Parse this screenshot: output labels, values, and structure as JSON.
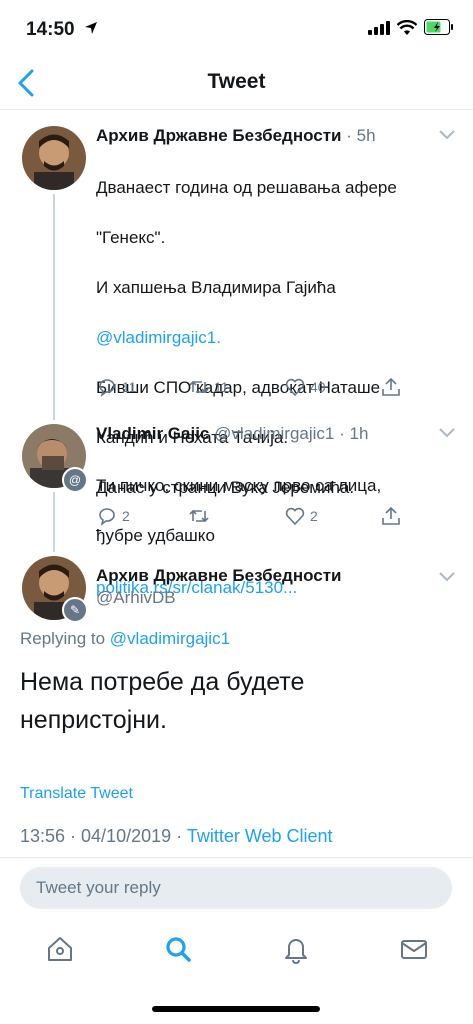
{
  "status": {
    "time": "14:50"
  },
  "nav": {
    "title": "Tweet"
  },
  "tweet1": {
    "name": "Архив Државне Безбедности",
    "meta": "· 5h",
    "text_lines": [
      "Дванаест година од решавања афере",
      "\"Генекс\".",
      "И хапшења Владимира Гајића",
      "Бивши СПО кадар, адвокат Наташе",
      "Кандић и Нехата Тачија.",
      "Данас у странци Вука Јеремића."
    ],
    "mention": "@vladimirgajic1.",
    "link": "politika.rs/sr/clanak/5130...",
    "replies": "11",
    "retweets": "11",
    "likes": "40"
  },
  "tweet2": {
    "name": "Vladimir Gajic",
    "handle": "@vladimirgajic1",
    "meta": "· 1h",
    "text_lines": [
      "Ти пичко, скини маску прво са лица,",
      "ђубре удбашко"
    ],
    "replies": "2",
    "retweets": "",
    "likes": "2"
  },
  "main": {
    "name": "Архив Државне Безбедности",
    "handle": "@ArhivDB",
    "replying_prefix": "Replying to",
    "replying_handle": "@vladimirgajic1",
    "text_line1": "Нема потребе да будете",
    "text_line2": "непристојни.",
    "translate": "Translate Tweet",
    "timestamp": "13:56 · 04/10/2019 ·",
    "client": "Twitter Web Client"
  },
  "reply_bar": {
    "placeholder": "Tweet your reply"
  },
  "colors": {
    "accent": "#1da1f2",
    "muted": "#657786"
  }
}
